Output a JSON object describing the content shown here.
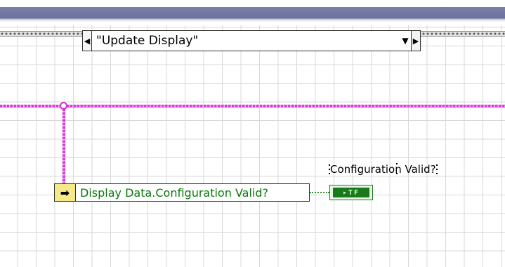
{
  "case_selector": {
    "value": "\"Update Display\"",
    "left_arrow": "◀",
    "dropdown_arrow": "▼",
    "right_arrow": "▶"
  },
  "unbundle_node": {
    "arrow": "➡",
    "element_label": "Display Data.Configuration Valid?"
  },
  "indicator": {
    "label": "Configuration Valid?",
    "terminal_text": "▸TF"
  },
  "colors": {
    "cluster_wire": "#e33be3",
    "boolean_wire": "#3a8f3a",
    "bool_terminal": "#1a7a1a",
    "unbundle_head": "#f5e98a"
  }
}
